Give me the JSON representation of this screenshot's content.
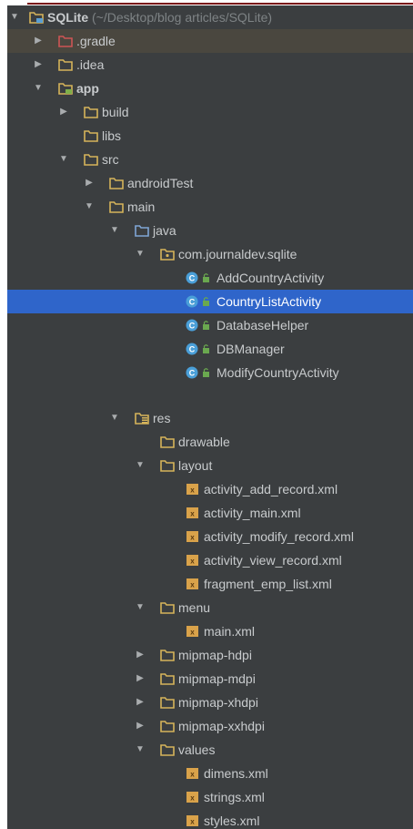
{
  "project_tree": {
    "root": {
      "label": "SQLite",
      "path": "(~/Desktop/blog articles/SQLite)"
    },
    "items": [
      {
        "label": "SQLite",
        "icon": "project-folder-icon"
      },
      {
        "label": ".gradle",
        "icon": "folder-icon"
      },
      {
        "label": ".idea",
        "icon": "folder-icon"
      },
      {
        "label": "app",
        "icon": "module-folder-icon"
      },
      {
        "label": "build",
        "icon": "folder-icon"
      },
      {
        "label": "libs",
        "icon": "folder-icon"
      },
      {
        "label": "src",
        "icon": "folder-icon"
      },
      {
        "label": "androidTest",
        "icon": "folder-icon"
      },
      {
        "label": "main",
        "icon": "folder-icon"
      },
      {
        "label": "java",
        "icon": "source-folder-icon"
      },
      {
        "label": "com.journaldev.sqlite",
        "icon": "package-folder-icon"
      },
      {
        "label": "AddCountryActivity",
        "icon": "java-class-icon"
      },
      {
        "label": "CountryListActivity",
        "icon": "java-class-icon"
      },
      {
        "label": "DatabaseHelper",
        "icon": "java-class-icon"
      },
      {
        "label": "DBManager",
        "icon": "java-class-icon"
      },
      {
        "label": "ModifyCountryActivity",
        "icon": "java-class-icon"
      },
      {
        "label": "res",
        "icon": "resource-folder-icon"
      },
      {
        "label": "drawable",
        "icon": "folder-icon"
      },
      {
        "label": "layout",
        "icon": "folder-icon"
      },
      {
        "label": "activity_add_record.xml",
        "icon": "xml-file-icon"
      },
      {
        "label": "activity_main.xml",
        "icon": "xml-file-icon"
      },
      {
        "label": "activity_modify_record.xml",
        "icon": "xml-file-icon"
      },
      {
        "label": "activity_view_record.xml",
        "icon": "xml-file-icon"
      },
      {
        "label": "fragment_emp_list.xml",
        "icon": "xml-file-icon"
      },
      {
        "label": "menu",
        "icon": "folder-icon"
      },
      {
        "label": "main.xml",
        "icon": "xml-file-icon"
      },
      {
        "label": "mipmap-hdpi",
        "icon": "folder-icon"
      },
      {
        "label": "mipmap-mdpi",
        "icon": "folder-icon"
      },
      {
        "label": "mipmap-xhdpi",
        "icon": "folder-icon"
      },
      {
        "label": "mipmap-xxhdpi",
        "icon": "folder-icon"
      },
      {
        "label": "values",
        "icon": "folder-icon"
      },
      {
        "label": "dimens.xml",
        "icon": "xml-file-icon"
      },
      {
        "label": "strings.xml",
        "icon": "xml-file-icon"
      },
      {
        "label": "styles.xml",
        "icon": "xml-file-icon"
      }
    ],
    "selected_item": "CountryListActivity",
    "colors": {
      "background": "#3b3e40",
      "selection": "#2f65ca",
      "highlight_row": "#4a473f",
      "text": "#c8cbcd",
      "folder_outline": "#d6b45a",
      "excluded_folder": "#cc5555",
      "source_folder": "#7fa6d6",
      "class_badge": "#4a9fd8"
    }
  }
}
